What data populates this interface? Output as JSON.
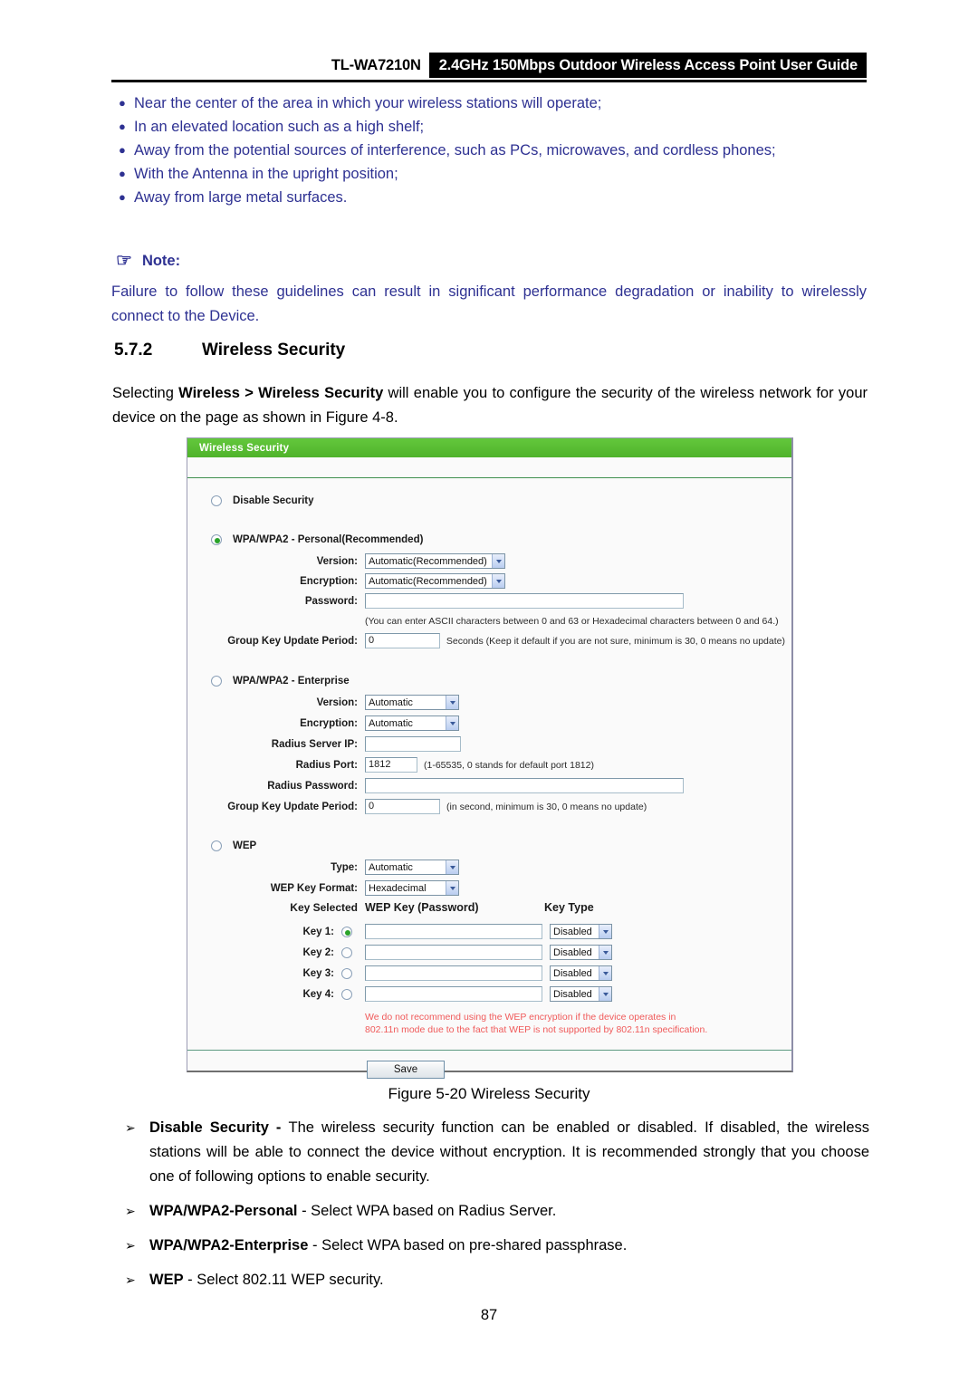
{
  "header": {
    "model": "TL-WA7210N",
    "title": "2.4GHz 150Mbps Outdoor Wireless Access Point User Guide"
  },
  "placement_bullets": [
    "Near the center of the area in which your wireless stations will operate;",
    "In an elevated location such as a high shelf;",
    "Away from the potential sources of interference, such as PCs, microwaves, and cordless phones;",
    "With the Antenna in the upright position;",
    "Away from large metal surfaces."
  ],
  "note": {
    "icon": "pointing-hand-icon",
    "glyph": "☞",
    "label": "Note:",
    "body": "Failure to follow these guidelines can result in significant performance degradation or inability to wirelessly connect to the Device."
  },
  "section": {
    "number": "5.7.2",
    "title": "Wireless Security",
    "intro_pre": "Selecting ",
    "intro_bold1": "Wireless > Wireless Security",
    "intro_post": " will enable you to configure the security of the wireless network for your device on the page as shown in Figure 4-8."
  },
  "router_ui": {
    "panel_title": "Wireless Security",
    "disable_security": {
      "label": "Disable Security",
      "selected": false
    },
    "wpa_personal": {
      "label": "WPA/WPA2 - Personal(Recommended)",
      "selected": true,
      "version_label": "Version:",
      "version_value": "Automatic(Recommended)",
      "encryption_label": "Encryption:",
      "encryption_value": "Automatic(Recommended)",
      "password_label": "Password:",
      "password_value": "",
      "password_hint": "(You can enter ASCII characters between 0 and 63 or Hexadecimal characters between 0 and 64.)",
      "group_key_label": "Group Key Update Period:",
      "group_key_value": "0",
      "group_key_hint": "Seconds (Keep it default if you are not sure, minimum is 30, 0 means no update)"
    },
    "wpa_enterprise": {
      "label": "WPA/WPA2 - Enterprise",
      "selected": false,
      "version_label": "Version:",
      "version_value": "Automatic",
      "encryption_label": "Encryption:",
      "encryption_value": "Automatic",
      "radius_ip_label": "Radius Server IP:",
      "radius_ip_value": "",
      "radius_port_label": "Radius Port:",
      "radius_port_value": "1812",
      "radius_port_hint": "(1-65535, 0 stands for default port 1812)",
      "radius_password_label": "Radius Password:",
      "radius_password_value": "",
      "group_key_label": "Group Key Update Period:",
      "group_key_value": "0",
      "group_key_hint": "(in second, minimum is 30, 0 means no update)"
    },
    "wep": {
      "label": "WEP",
      "selected": false,
      "type_label": "Type:",
      "type_value": "Automatic",
      "key_format_label": "WEP Key Format:",
      "key_format_value": "Hexadecimal",
      "col_key_selected": "Key Selected",
      "col_wep_key": "WEP Key (Password)",
      "col_key_type": "Key Type",
      "keys": [
        {
          "label": "Key 1:",
          "selected": true,
          "value": "",
          "type": "Disabled"
        },
        {
          "label": "Key 2:",
          "selected": false,
          "value": "",
          "type": "Disabled"
        },
        {
          "label": "Key 3:",
          "selected": false,
          "value": "",
          "type": "Disabled"
        },
        {
          "label": "Key 4:",
          "selected": false,
          "value": "",
          "type": "Disabled"
        }
      ],
      "warning_line1": "We do not recommend using the WEP encryption if the device operates in",
      "warning_line2": "802.11n mode due to the fact that WEP is not supported by 802.11n specification."
    },
    "save_label": "Save"
  },
  "figure_caption": "Figure 5-20 Wireless Security",
  "descriptions": [
    {
      "term": "Disable Security - ",
      "text": "The wireless security function can be enabled or disabled. If disabled, the wireless stations will be able to connect the device without encryption. It is recommended strongly that you choose one of following options to enable security."
    },
    {
      "term": "WPA/WPA2-Personal",
      "text": " - Select WPA based on Radius Server."
    },
    {
      "term": "WPA/WPA2-Enterprise",
      "text": " - Select WPA based on pre-shared passphrase."
    },
    {
      "term": "WEP",
      "text": " - Select 802.11 WEP security."
    }
  ],
  "page_number": "87",
  "colors": {
    "brand_green": "#5cc035",
    "body_blue": "#2e3192",
    "warning_red": "#f05a5a"
  }
}
